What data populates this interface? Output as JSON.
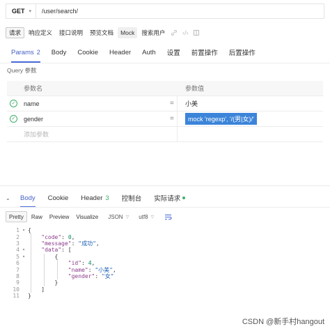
{
  "request": {
    "method": "GET",
    "url": "/user/search/"
  },
  "toolbar": {
    "items": [
      {
        "label": "请求",
        "active": true
      },
      {
        "label": "响应定义"
      },
      {
        "label": "接口说明"
      },
      {
        "label": "预览文档"
      },
      {
        "label": "Mock",
        "mock": true
      },
      {
        "label": "搜索用户"
      }
    ]
  },
  "tabs": [
    {
      "label": "Params",
      "count": "2",
      "active": true
    },
    {
      "label": "Body"
    },
    {
      "label": "Cookie"
    },
    {
      "label": "Header"
    },
    {
      "label": "Auth"
    },
    {
      "label": "设置"
    },
    {
      "label": "前置操作"
    },
    {
      "label": "后置操作"
    }
  ],
  "query": {
    "title": "Query 参数",
    "col_name": "参数名",
    "col_value": "参数值",
    "eq": "=",
    "rows": [
      {
        "name": "name",
        "value": "小美"
      },
      {
        "name": "gender",
        "value": "mock 'regexp', '/(男|女)/'"
      }
    ],
    "add_placeholder": "添加参数"
  },
  "response": {
    "tabs": [
      {
        "label": "Body",
        "active": true
      },
      {
        "label": "Cookie"
      },
      {
        "label": "Header",
        "count": "3"
      },
      {
        "label": "控制台"
      },
      {
        "label": "实际请求",
        "dot": true
      }
    ],
    "view_buttons": [
      "Pretty",
      "Raw",
      "Preview",
      "Visualize"
    ],
    "format": "JSON",
    "encoding": "utf8",
    "code_lines": [
      "{",
      "    \"code\": 0,",
      "    \"message\": \"成功\",",
      "    \"data\": [",
      "        {",
      "            \"id\": 4,",
      "            \"name\": \"小美\",",
      "            \"gender\": \"女\"",
      "        }",
      "    ]",
      "}"
    ]
  },
  "watermark": "CSDN @新手村hangout",
  "colors": {
    "accent": "#4a6cdb",
    "success": "#3fae6a",
    "mock_pill": "#3b84d9"
  }
}
